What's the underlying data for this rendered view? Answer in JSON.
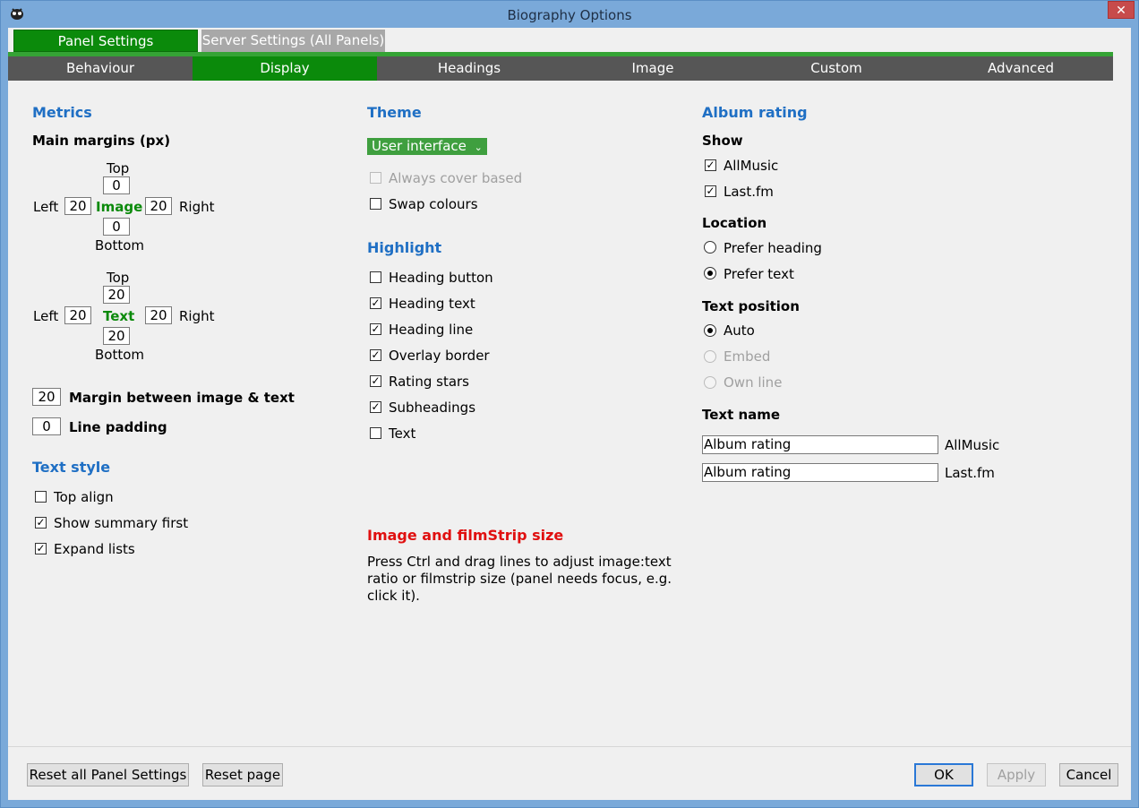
{
  "window": {
    "title": "Biography Options",
    "close_label": "✕"
  },
  "top_tabs": [
    {
      "label": "Panel Settings",
      "active": true
    },
    {
      "label": "Server Settings (All Panels)",
      "active": false
    }
  ],
  "sub_tabs": [
    {
      "label": "Behaviour"
    },
    {
      "label": "Display"
    },
    {
      "label": "Headings"
    },
    {
      "label": "Image"
    },
    {
      "label": "Custom"
    },
    {
      "label": "Advanced"
    }
  ],
  "metrics": {
    "heading": "Metrics",
    "main_margins_label": "Main margins (px)",
    "image": {
      "center": "Image",
      "top_label": "Top",
      "top": "0",
      "left_label": "Left",
      "left": "20",
      "right": "20",
      "right_label": "Right",
      "bottom": "0",
      "bottom_label": "Bottom"
    },
    "text": {
      "center": "Text",
      "top_label": "Top",
      "top": "20",
      "left_label": "Left",
      "left": "20",
      "right": "20",
      "right_label": "Right",
      "bottom": "20",
      "bottom_label": "Bottom"
    },
    "margin_between": {
      "value": "20",
      "label": "Margin between image & text"
    },
    "line_padding": {
      "value": "0",
      "label": "Line padding"
    }
  },
  "text_style": {
    "heading": "Text style",
    "items": [
      {
        "label": "Top align",
        "checked": false
      },
      {
        "label": "Show summary first",
        "checked": true
      },
      {
        "label": "Expand lists",
        "checked": true
      }
    ]
  },
  "theme": {
    "heading": "Theme",
    "dropdown_value": "User interface",
    "always_cover": {
      "label": "Always cover based",
      "checked": false,
      "disabled": true
    },
    "swap_colours": {
      "label": "Swap colours",
      "checked": false
    }
  },
  "highlight": {
    "heading": "Highlight",
    "items": [
      {
        "label": "Heading button",
        "checked": false
      },
      {
        "label": "Heading text",
        "checked": true
      },
      {
        "label": "Heading line",
        "checked": true
      },
      {
        "label": "Overlay border",
        "checked": true
      },
      {
        "label": "Rating stars",
        "checked": true
      },
      {
        "label": "Subheadings",
        "checked": true
      },
      {
        "label": "Text",
        "checked": false
      }
    ]
  },
  "filmstrip": {
    "heading": "Image and filmStrip size",
    "text": "Press Ctrl and drag lines to adjust image:text ratio or filmstrip size (panel needs focus, e.g. click it)."
  },
  "album_rating": {
    "heading": "Album rating",
    "show_label": "Show",
    "show": [
      {
        "label": "AllMusic",
        "checked": true
      },
      {
        "label": "Last.fm",
        "checked": true
      }
    ],
    "location_label": "Location",
    "location": [
      {
        "label": "Prefer heading",
        "selected": false
      },
      {
        "label": "Prefer text",
        "selected": true
      }
    ],
    "text_position_label": "Text position",
    "text_position": [
      {
        "label": "Auto",
        "selected": true,
        "disabled": false
      },
      {
        "label": "Embed",
        "selected": false,
        "disabled": true
      },
      {
        "label": "Own line",
        "selected": false,
        "disabled": true
      }
    ],
    "text_name_label": "Text name",
    "text_names": [
      {
        "value": "Album rating",
        "source": "AllMusic"
      },
      {
        "value": "Album rating",
        "source": "Last.fm"
      }
    ]
  },
  "footer": {
    "reset_all": "Reset all Panel Settings",
    "reset_page": "Reset page",
    "ok": "OK",
    "apply": "Apply",
    "cancel": "Cancel"
  }
}
